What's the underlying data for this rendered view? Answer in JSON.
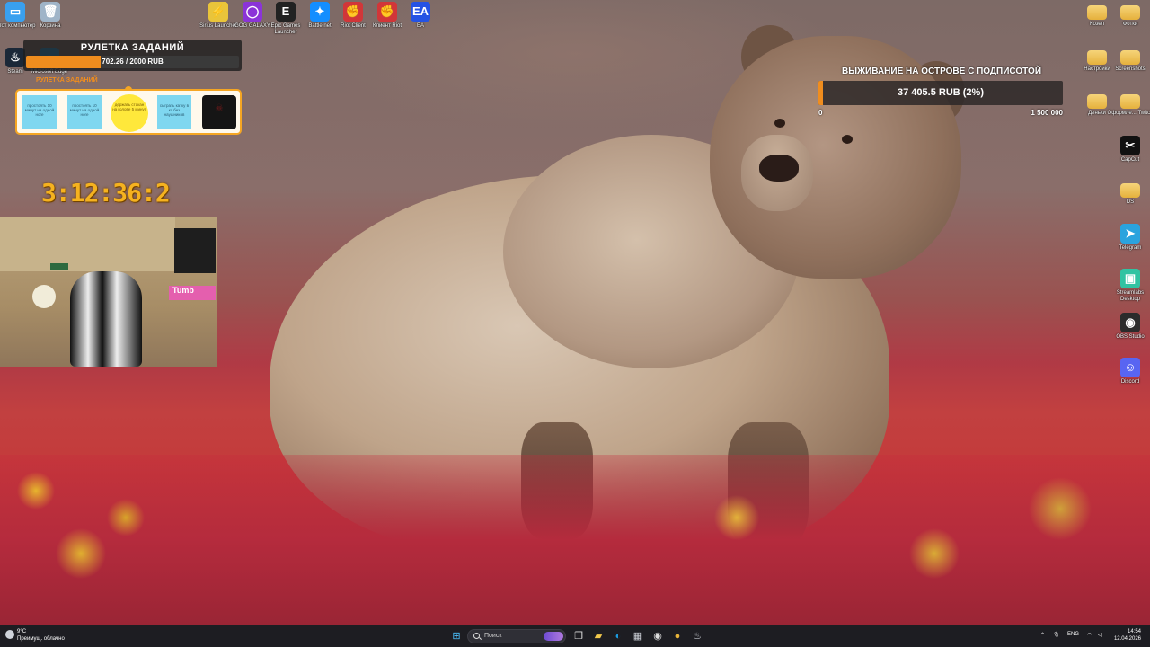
{
  "desktop_icons": [
    {
      "id": "this-pc",
      "label": "Этот компьютер",
      "glyph": "▭",
      "color": "#39a0ef"
    },
    {
      "id": "recycle-bin",
      "label": "Корзина",
      "glyph": "🗑",
      "color": "#9fb4c8"
    },
    {
      "id": "sirius-launcher",
      "label": "Sirius Launcher",
      "glyph": "⚡",
      "color": "#e9c43a"
    },
    {
      "id": "gog-galaxy",
      "label": "GOG GALAXY",
      "glyph": "◯",
      "color": "#8b34d8"
    },
    {
      "id": "epic-games-launcher",
      "label": "Epic Games Launcher",
      "glyph": "E",
      "color": "#222222"
    },
    {
      "id": "battle-net",
      "label": "Battle.net",
      "glyph": "✦",
      "color": "#148eff"
    },
    {
      "id": "riot-client",
      "label": "Riot Client",
      "glyph": "✊",
      "color": "#d13639"
    },
    {
      "id": "klient-riot",
      "label": "Клиент Riot",
      "glyph": "✊",
      "color": "#d13639"
    },
    {
      "id": "ea",
      "label": "EA",
      "glyph": "EA",
      "color": "#2553e4"
    },
    {
      "id": "steam",
      "label": "Steam",
      "glyph": "♨",
      "color": "#1b2838"
    },
    {
      "id": "microsoft-edge",
      "label": "Microsoft Edge",
      "glyph": "◐",
      "color": "#1b9de2"
    },
    {
      "id": "kozel",
      "label": "Козел",
      "glyph": "",
      "color": "#e6b13c"
    },
    {
      "id": "fotki",
      "label": "Фотки",
      "glyph": "",
      "color": "#e6b13c"
    },
    {
      "id": "nastroyki",
      "label": "Настройки",
      "glyph": "",
      "color": "#e6b13c"
    },
    {
      "id": "screenshots",
      "label": "Screenshots",
      "glyph": "",
      "color": "#e6b13c"
    },
    {
      "id": "denyuzhki",
      "label": "Деньки",
      "glyph": "",
      "color": "#e6b13c"
    },
    {
      "id": "oformlenie-twitch",
      "label": "Оформле... Twitch",
      "glyph": "",
      "color": "#e6b13c"
    },
    {
      "id": "capcut",
      "label": "CapCut",
      "glyph": "✂",
      "color": "#111111"
    },
    {
      "id": "ds",
      "label": "DS",
      "glyph": "",
      "color": "#e6b13c"
    },
    {
      "id": "telegram",
      "label": "Telegram",
      "glyph": "➤",
      "color": "#2aa3de"
    },
    {
      "id": "streamlabs-desktop",
      "label": "Streamlabs Desktop",
      "glyph": "▣",
      "color": "#31c3a2"
    },
    {
      "id": "obs-studio",
      "label": "OBS Studio",
      "glyph": "◉",
      "color": "#2b2b2b"
    },
    {
      "id": "discord",
      "label": "Discord",
      "glyph": "☺",
      "color": "#5865f2"
    }
  ],
  "roulette": {
    "title": "РУЛЕТКА ЗАДАНИЙ",
    "amount": "702.26 / 2000 RUB",
    "progress": 0.351,
    "wheel_label": "РУЛЕТКА ЗАДАНИЙ",
    "cards": [
      "простоять 10 минут на одной ноге",
      "простоять 10 минут на одной ноге",
      "держать стакан на голове 5 минут",
      "сыграть катку в кс без наушников",
      "☠"
    ]
  },
  "timer": "3:12:36:2",
  "webcam": {
    "sign_text": "Tumb"
  },
  "survival": {
    "title": "ВЫЖИВАНИЕ НА ОСТРОВЕ С ПОДПИСОТОЙ",
    "amount": "37 405.5 RUB (2%)",
    "progress": 0.02,
    "min": "0",
    "max": "1 500 000"
  },
  "taskbar": {
    "weather_temp": "9°C",
    "weather_desc": "Преимущ. облачно",
    "search_placeholder": "Поиск",
    "lang": "ENG",
    "time": "14:54",
    "date": "12.04.2026",
    "pinned_apps": [
      {
        "id": "task-view",
        "glyph": "❐",
        "color": "#dddddd"
      },
      {
        "id": "file-explorer",
        "glyph": "▰",
        "color": "#f2c94c"
      },
      {
        "id": "edge",
        "glyph": "◐",
        "color": "#1b9de2"
      },
      {
        "id": "store",
        "glyph": "▦",
        "color": "#cfd3da"
      },
      {
        "id": "obs",
        "glyph": "◉",
        "color": "#dddddd"
      },
      {
        "id": "chrome",
        "glyph": "●",
        "color": "#e9b53a"
      },
      {
        "id": "steam",
        "glyph": "♨",
        "color": "#cfd3da"
      }
    ],
    "accent": "#4cc2ff"
  }
}
